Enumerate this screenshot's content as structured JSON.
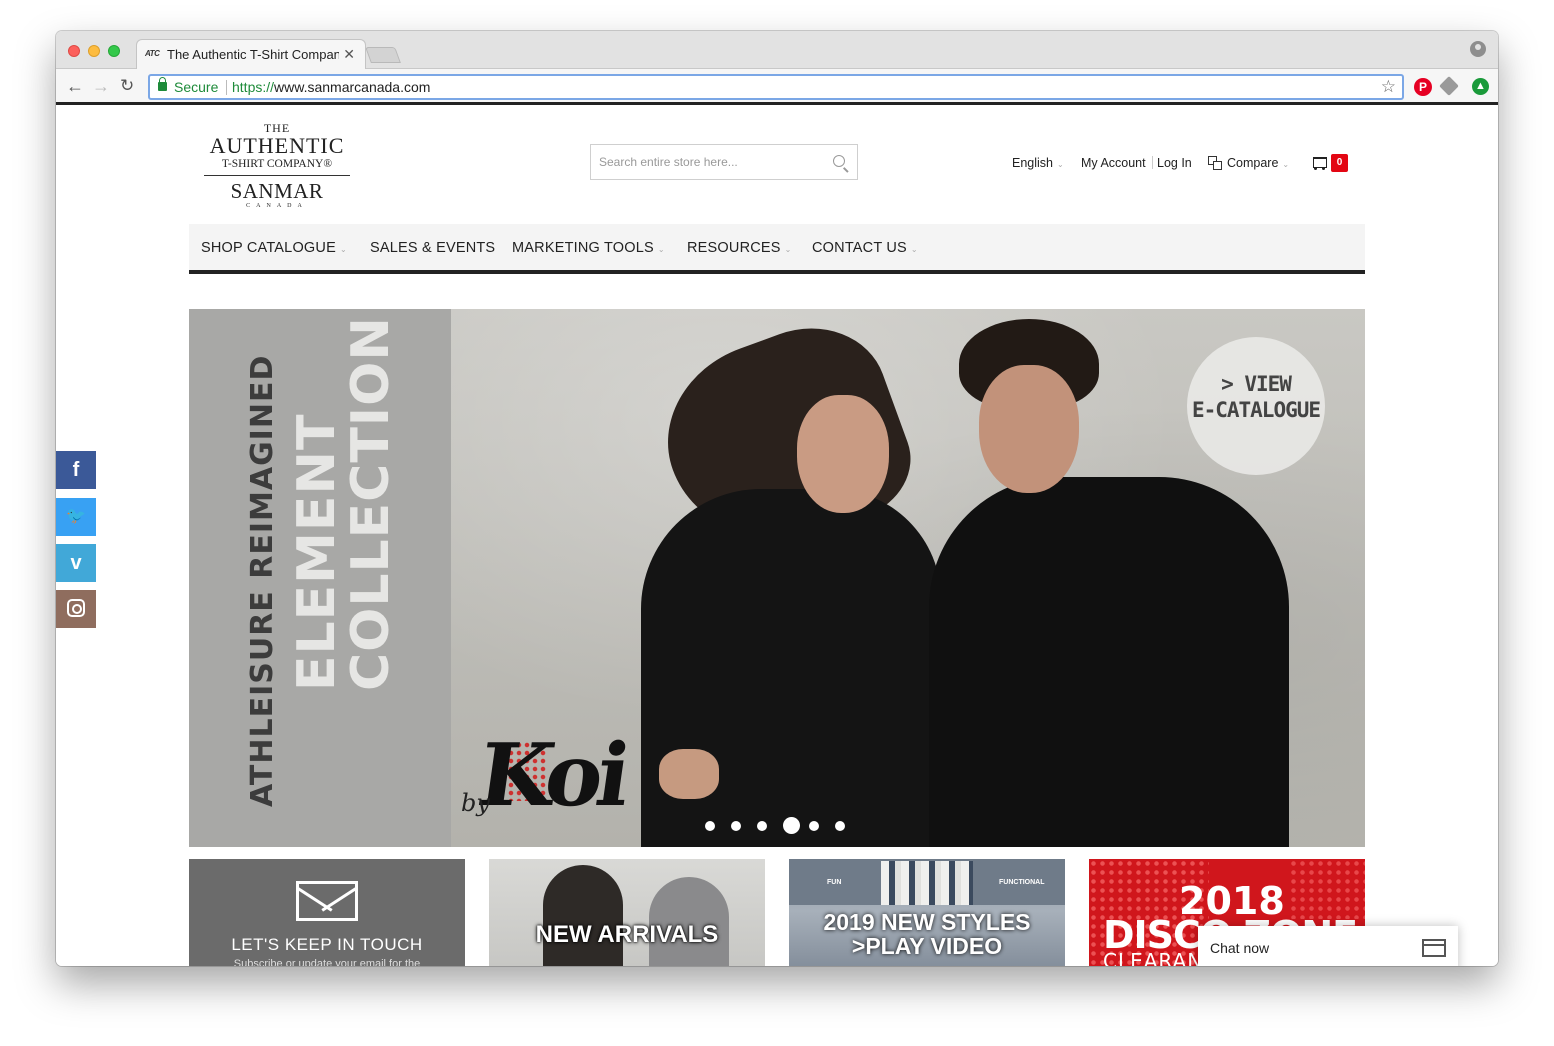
{
  "browser": {
    "tab_title": "The Authentic T-Shirt Company",
    "tab_favicon": "ATC",
    "url_secure_label": "Secure",
    "url_scheme": "https://",
    "url_host": "www.sanmarcanada.com",
    "icons": [
      "back-arrow-icon",
      "forward-arrow-icon",
      "reload-icon",
      "lock-icon",
      "star-icon",
      "pinterest-icon",
      "tag-icon",
      "upload-icon",
      "profile-icon"
    ]
  },
  "logo": {
    "line1": "THE",
    "line2": "AUTHENTIC",
    "line3": "T-SHIRT COMPANY®",
    "line4": "SANMAR",
    "line5": "CANADA"
  },
  "search": {
    "placeholder": "Search entire store here..."
  },
  "header": {
    "language": "English",
    "my_account": "My Account",
    "login": "Log In",
    "compare": "Compare",
    "cart_count": "0"
  },
  "nav": {
    "items": [
      {
        "label": "SHOP CATALOGUE",
        "has_dropdown": true
      },
      {
        "label": "SALES & EVENTS",
        "has_dropdown": false
      },
      {
        "label": "MARKETING TOOLS",
        "has_dropdown": true
      },
      {
        "label": "RESOURCES",
        "has_dropdown": true
      },
      {
        "label": "CONTACT US",
        "has_dropdown": true
      }
    ]
  },
  "hero": {
    "vertical_line1": "ATHLEISURE REIMAGINED",
    "vertical_line2": "ELEMENT",
    "vertical_line3": "COLLECTION",
    "brand_by": "by",
    "brand_mark": "Koi",
    "cta_line1": "> VIEW",
    "cta_line2": "E-CATALOGUE",
    "slide_count": 6,
    "active_slide": 4
  },
  "social": {
    "facebook": "f",
    "twitter": "t",
    "vimeo": "v"
  },
  "tiles": {
    "tile1_title": "LET'S KEEP IN TOUCH",
    "tile1_sub": "Subscribe or update your email for the",
    "tile2_title": "NEW ARRIVALS",
    "tile3_label_left": "FUN",
    "tile3_label_right": "FUNCTIONAL",
    "tile3_line1": "2019 NEW STYLES",
    "tile3_line2": ">PLAY VIDEO",
    "tile4_line1": "2018",
    "tile4_line2": "DISCO ZONE",
    "tile4_line3": "CLEARANCE"
  },
  "chat": {
    "label": "Chat now"
  },
  "colors": {
    "accent_red": "#e30613",
    "nav_border": "#222222",
    "secure_green": "#1e8b3a",
    "facebook": "#3b5998",
    "twitter": "#38a1f3",
    "vimeo": "#41a8d8",
    "instagram": "#8f6d5e"
  }
}
